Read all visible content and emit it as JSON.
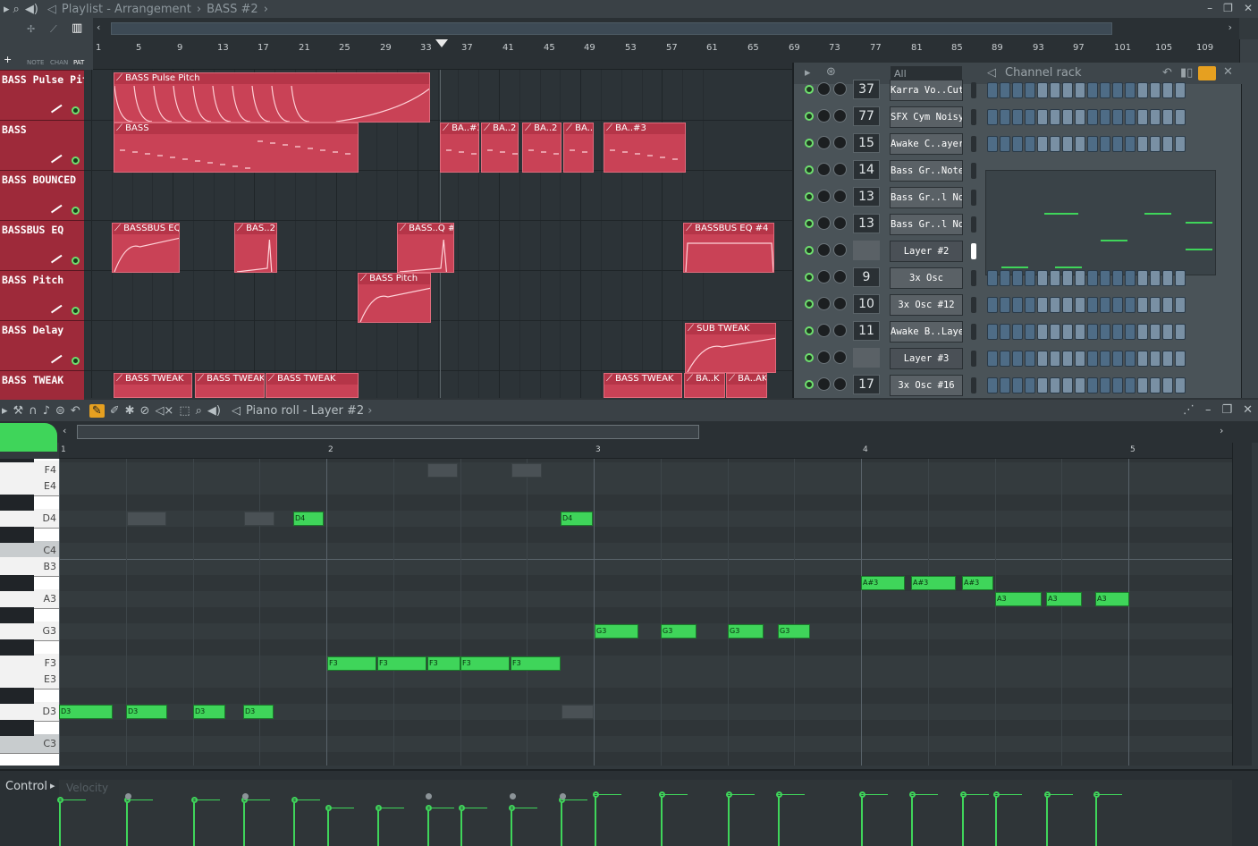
{
  "playlist": {
    "title": "Playlist - Arrangement",
    "pattern": "BASS #2",
    "tool_labels": [
      "NOTE",
      "CHAN",
      "PAT"
    ],
    "ruler": [
      "1",
      "5",
      "9",
      "13",
      "17",
      "21",
      "25",
      "29",
      "33",
      "37",
      "41",
      "45",
      "49",
      "53",
      "57",
      "61",
      "65",
      "69",
      "73",
      "77",
      "81",
      "85",
      "89",
      "93",
      "97",
      "101",
      "105",
      "109"
    ],
    "tracks": [
      "BASS Pulse Pitch",
      "BASS",
      "BASS BOUNCED",
      "BASSBUS EQ",
      "BASS Pitch",
      "BASS Delay",
      "BASS TWEAK"
    ],
    "clips": [
      {
        "label": "BASS Pulse Pitch"
      },
      {
        "label": "BASS"
      },
      {
        "label": "BA..#2"
      },
      {
        "label": "BA..2"
      },
      {
        "label": "BA..2"
      },
      {
        "label": "BA..#3"
      },
      {
        "label": "BA..#3"
      },
      {
        "label": "BASSBUS EQ"
      },
      {
        "label": "BAS..2"
      },
      {
        "label": "BASS..Q #3"
      },
      {
        "label": "BASSBUS EQ #4"
      },
      {
        "label": "BASS Pitch"
      },
      {
        "label": "SUB TWEAK"
      },
      {
        "label": "BASS TWEAK"
      },
      {
        "label": "BASS TWEAK"
      },
      {
        "label": "BASS TWEAK"
      },
      {
        "label": "BASS TWEAK"
      },
      {
        "label": "BA..K"
      },
      {
        "label": "BA..AK"
      }
    ],
    "accent": "#c94256"
  },
  "channel_rack": {
    "title": "Channel rack",
    "filter": "All",
    "channels": [
      {
        "num": "37",
        "name": "Karra Vo..Cut #3"
      },
      {
        "num": "77",
        "name": "SFX Cym Noisy"
      },
      {
        "num": "15",
        "name": "Awake C..ayer 2"
      },
      {
        "num": "14",
        "name": "Bass Gr..Notes 2"
      },
      {
        "num": "13",
        "name": "Bass Gr..l Notes"
      },
      {
        "num": "13",
        "name": "Bass Gr..l Notes"
      },
      {
        "num": "",
        "name": "Layer #2"
      },
      {
        "num": "9",
        "name": "3x Osc"
      },
      {
        "num": "10",
        "name": "3x Osc #12"
      },
      {
        "num": "11",
        "name": "Awake B..Layer"
      },
      {
        "num": "",
        "name": "Layer #3"
      },
      {
        "num": "17",
        "name": "3x Osc #16"
      }
    ]
  },
  "piano_roll": {
    "title": "Piano roll - Layer #2",
    "bars": [
      "1",
      "2",
      "3",
      "4",
      "5"
    ],
    "key_labels": [
      "F4",
      "E4",
      "D4",
      "C4",
      "B3",
      "A3",
      "G3",
      "F3",
      "E3",
      "D3",
      "C3"
    ],
    "notes": [
      {
        "label": "D3"
      },
      {
        "label": "D3"
      },
      {
        "label": "D3"
      },
      {
        "label": "D3"
      },
      {
        "label": "D4"
      },
      {
        "label": "D4"
      },
      {
        "label": "F3"
      },
      {
        "label": "F3"
      },
      {
        "label": "F3"
      },
      {
        "label": "F3"
      },
      {
        "label": "F3"
      },
      {
        "label": "G3"
      },
      {
        "label": "G3"
      },
      {
        "label": "G3"
      },
      {
        "label": "G3"
      },
      {
        "label": "A#3"
      },
      {
        "label": "A#3"
      },
      {
        "label": "A#3"
      },
      {
        "label": "A3"
      },
      {
        "label": "A3"
      },
      {
        "label": "A3"
      }
    ],
    "note_color": "#3fd55a",
    "control": {
      "label": "Control",
      "param": "Velocity"
    }
  }
}
